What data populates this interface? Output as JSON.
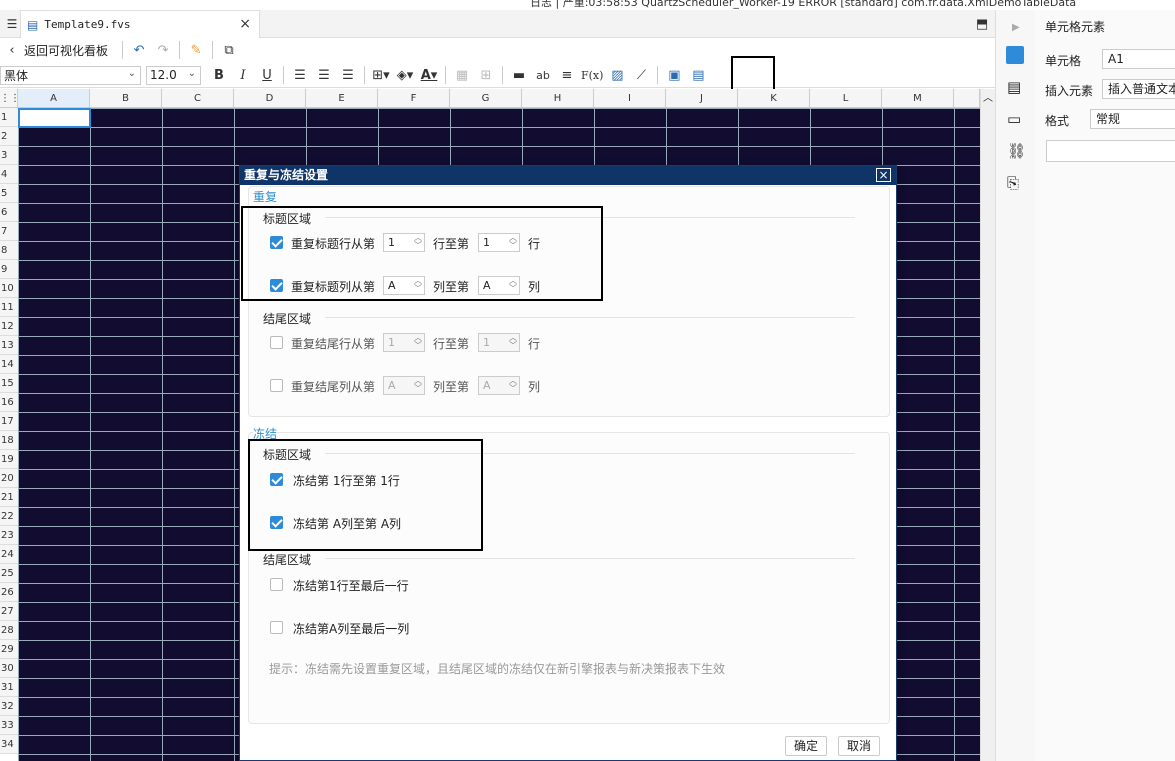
{
  "top_strip": {
    "text": "日志 | 严重:03:58:53 QuartzScheduler_Worker-19 ERROR [standard] com.fr.data.XmlDemoTableData"
  },
  "tab": {
    "title": "Template9.fvs",
    "close": "×"
  },
  "toolbar1": {
    "back_label": "返回可视化看板"
  },
  "toolbar2": {
    "font": "黑体",
    "font_size": "12.0",
    "bold": "B",
    "italic": "I",
    "underline": "U",
    "ab": "ab",
    "fx": "F(x)"
  },
  "columns": [
    "A",
    "B",
    "C",
    "D",
    "E",
    "F",
    "G",
    "H",
    "I",
    "J",
    "K",
    "L",
    "M"
  ],
  "rows": [
    "1",
    "2",
    "3",
    "4",
    "5",
    "6",
    "7",
    "8",
    "9",
    "10",
    "11",
    "12",
    "13",
    "14",
    "15",
    "16",
    "17",
    "18",
    "19",
    "20",
    "21",
    "22",
    "23",
    "24",
    "25",
    "26",
    "27",
    "28",
    "29",
    "30",
    "31",
    "32",
    "33",
    "34"
  ],
  "right_panel": {
    "title": "单元格元素",
    "cell_label": "单元格",
    "cell_value": "A1",
    "insert_label": "插入元素",
    "insert_value": "插入普通文本",
    "format_label": "格式",
    "format_value": "常规"
  },
  "dialog": {
    "title": "重复与冻结设置",
    "close": "×",
    "repeat_section": "重复",
    "header_area": "标题区域",
    "repeat_row_label": "重复标题行从第",
    "repeat_row_from": "1",
    "repeat_row_to_label": "行至第",
    "repeat_row_to": "1",
    "repeat_row_suffix": "行",
    "repeat_col_label": "重复标题列从第",
    "repeat_col_from": "A",
    "repeat_col_to_label": "列至第",
    "repeat_col_to": "A",
    "repeat_col_suffix": "列",
    "footer_area": "结尾区域",
    "footer_row_label": "重复结尾行从第",
    "footer_row_from": "1",
    "footer_row_to_label": "行至第",
    "footer_row_to": "1",
    "footer_row_suffix": "行",
    "footer_col_label": "重复结尾列从第",
    "footer_col_from": "A",
    "footer_col_to_label": "列至第",
    "footer_col_to": "A",
    "footer_col_suffix": "列",
    "freeze_section": "冻结",
    "freeze_header_area": "标题区域",
    "freeze_row_label": "冻结第 1行至第 1行",
    "freeze_col_label": "冻结第 A列至第 A列",
    "freeze_footer_area": "结尾区域",
    "freeze_footer_row_label": "冻结第1行至最后一行",
    "freeze_footer_col_label": "冻结第A列至最后一列",
    "hint": "提示：冻结需先设置重复区域，且结尾区域的冻结仅在新引擎报表与新决策报表下生效",
    "ok": "确定",
    "cancel": "取消"
  },
  "colors": {
    "dialog_title_bg": "#0e3468",
    "accent": "#2d8bd9",
    "grid_bg": "#120c30"
  }
}
